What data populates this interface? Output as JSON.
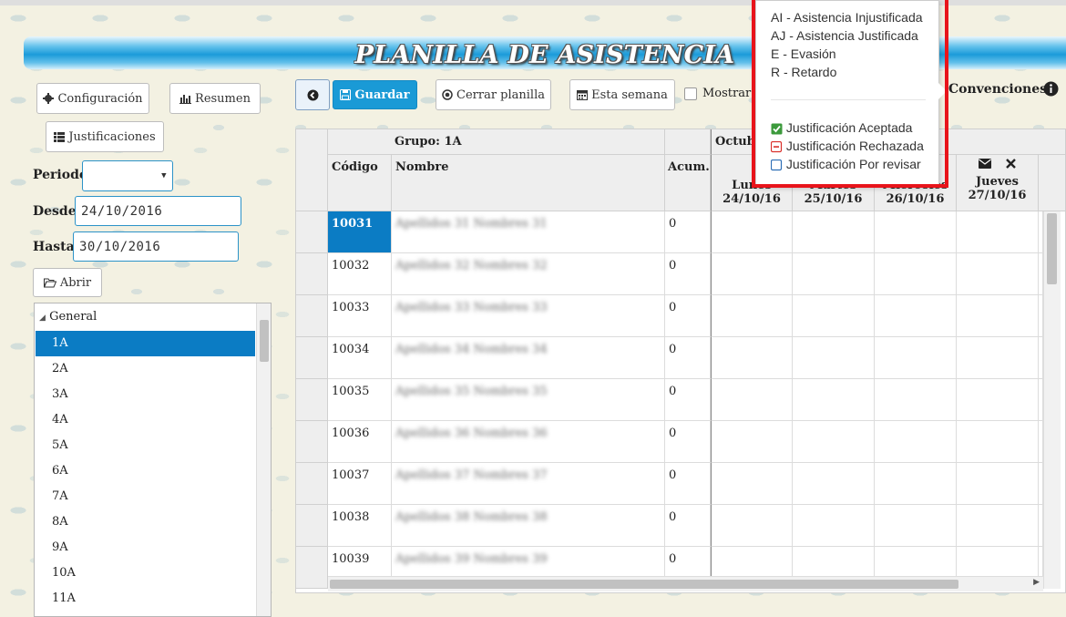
{
  "title": "PLANILLA DE ASISTENCIA",
  "left_panel": {
    "config_label": "Configuración",
    "resumen_label": "Resumen",
    "justificaciones_label": "Justificaciones",
    "periodo_label": "Periodo",
    "periodo_value": "",
    "desde_label": "Desde",
    "desde_value": "24/10/2016",
    "hasta_label": "Hasta",
    "hasta_value": "30/10/2016",
    "abrir_label": "Abrir",
    "tree": {
      "root": "General",
      "items": [
        "1A",
        "2A",
        "3A",
        "4A",
        "5A",
        "6A",
        "7A",
        "8A",
        "9A",
        "10A",
        "11A"
      ],
      "selected": "1A"
    }
  },
  "toolbar": {
    "guardar_label": "Guardar",
    "cerrar_label": "Cerrar planilla",
    "semana_label": "Esta semana",
    "mostrar_label": "Mostrar",
    "convenciones_label": "Convenciones"
  },
  "grid": {
    "group_label": "Grupo: 1A",
    "month_label": "Octubre",
    "col_codigo": "Código",
    "col_nombre": "Nombre",
    "col_acum": "Acum.",
    "days": [
      {
        "name": "Lunes",
        "date": "24/10/16"
      },
      {
        "name": "Martes",
        "date": "25/10/16"
      },
      {
        "name": "Miércoles",
        "date": "26/10/16"
      },
      {
        "name": "Jueves",
        "date": "27/10/16"
      }
    ],
    "rows": [
      {
        "code": "10031",
        "name": "Apellidos 31 Nombres 31",
        "acum": "0"
      },
      {
        "code": "10032",
        "name": "Apellidos 32 Nombres 32",
        "acum": "0"
      },
      {
        "code": "10033",
        "name": "Apellidos 33 Nombres 33",
        "acum": "0"
      },
      {
        "code": "10034",
        "name": "Apellidos 34 Nombres 34",
        "acum": "0"
      },
      {
        "code": "10035",
        "name": "Apellidos 35 Nombres 35",
        "acum": "0"
      },
      {
        "code": "10036",
        "name": "Apellidos 36 Nombres 36",
        "acum": "0"
      },
      {
        "code": "10037",
        "name": "Apellidos 37 Nombres 37",
        "acum": "0"
      },
      {
        "code": "10038",
        "name": "Apellidos 38 Nombres 38",
        "acum": "0"
      },
      {
        "code": "10039",
        "name": "Apellidos 39 Nombres 39",
        "acum": "0"
      }
    ]
  },
  "popover": {
    "conventions": [
      "AI - Asistencia Injustificada",
      "AJ - Asistencia Justificada",
      "E - Evasión",
      "R - Retardo"
    ],
    "status": [
      {
        "label": "Justificación Aceptada",
        "icon": "check-square-icon",
        "color": "#3c9a3c"
      },
      {
        "label": "Justificación Rechazada",
        "icon": "minus-square-icon",
        "color": "#d9302b"
      },
      {
        "label": "Justificación Por revisar",
        "icon": "empty-square-icon",
        "color": "#2f6fb6"
      }
    ]
  },
  "colors": {
    "accent": "#1a9ad6",
    "selected": "#0b7cc4",
    "highlight": "#e8141b"
  }
}
